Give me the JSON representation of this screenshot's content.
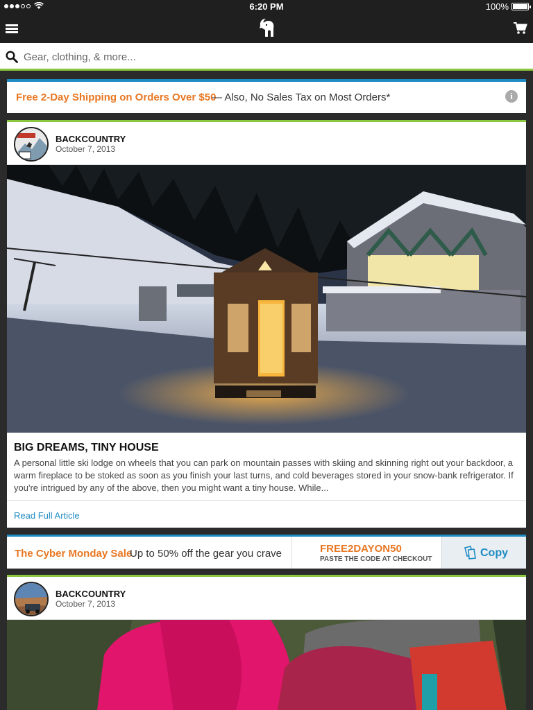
{
  "status_bar": {
    "time": "6:20 PM",
    "battery": "100%"
  },
  "nav": {
    "menu_icon": "menu-icon",
    "logo_icon": "goat-logo-icon",
    "cart_icon": "cart-icon"
  },
  "search": {
    "placeholder": "Gear, clothing, & more..."
  },
  "shipping_banner": {
    "main": "Free 2-Day Shipping on Orders Over $50",
    "sub": "— Also,  No Sales Tax on Most Orders*",
    "info_icon": "info-icon"
  },
  "posts": [
    {
      "author": "BACKCOUNTRY",
      "date": "October 7, 2013",
      "title": "BIG DREAMS, TINY HOUSE",
      "excerpt": "A personal little ski lodge on wheels that you can park on mountain passes with skiing and skinning right out your backdoor, a warm fireplace to be stoked as soon as you finish your last turns, and cold beverages stored in your snow-bank refrigerator. If you're intrigued by any of the above, then you might want a tiny house. While...",
      "link": "Read Full Article"
    },
    {
      "author": "BACKCOUNTRY",
      "date": "October 7, 2013"
    }
  ],
  "promo": {
    "title": "The Cyber Monday Sale",
    "sub": "Up to 50% off the gear you crave",
    "code": "FREE2DAYON50",
    "code_note": "PASTE THE CODE AT CHECKOUT",
    "copy_label": "Copy"
  },
  "colors": {
    "accent_orange": "#e87722",
    "accent_blue": "#1e8bc3",
    "accent_green": "#8dc63f",
    "nav_bg": "#1f1f1f"
  }
}
